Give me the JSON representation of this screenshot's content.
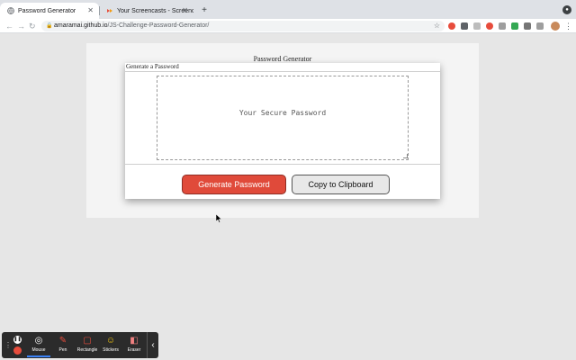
{
  "browser": {
    "tabs": [
      {
        "title": "Password Generator",
        "favicon": "globe-icon",
        "active": true
      },
      {
        "title": "Your Screencasts - Screencast",
        "favicon": "screencastify-icon",
        "active": false
      }
    ],
    "url_host": "amaramai.github.io",
    "url_path": "/JS-Challenge-Password-Generator/"
  },
  "page": {
    "heading": "Password Generator",
    "card_header": "Generate a Password",
    "password_placeholder": "Your Secure Password",
    "generate_label": "Generate Password",
    "copy_label": "Copy to Clipboard"
  },
  "dock": {
    "tools": [
      {
        "label": "Mouse",
        "icon": "mouse-icon",
        "active": true
      },
      {
        "label": "Pen",
        "icon": "pen-icon",
        "active": false
      },
      {
        "label": "Rectangle",
        "icon": "rectangle-icon",
        "active": false
      },
      {
        "label": "Stickers",
        "icon": "sticker-icon",
        "active": false
      },
      {
        "label": "Eraser",
        "icon": "eraser-icon",
        "active": false
      }
    ]
  },
  "colors": {
    "generate_button": "#e04a3a",
    "copy_button": "#e8e8e8",
    "page_background": "#e6e6e6"
  }
}
